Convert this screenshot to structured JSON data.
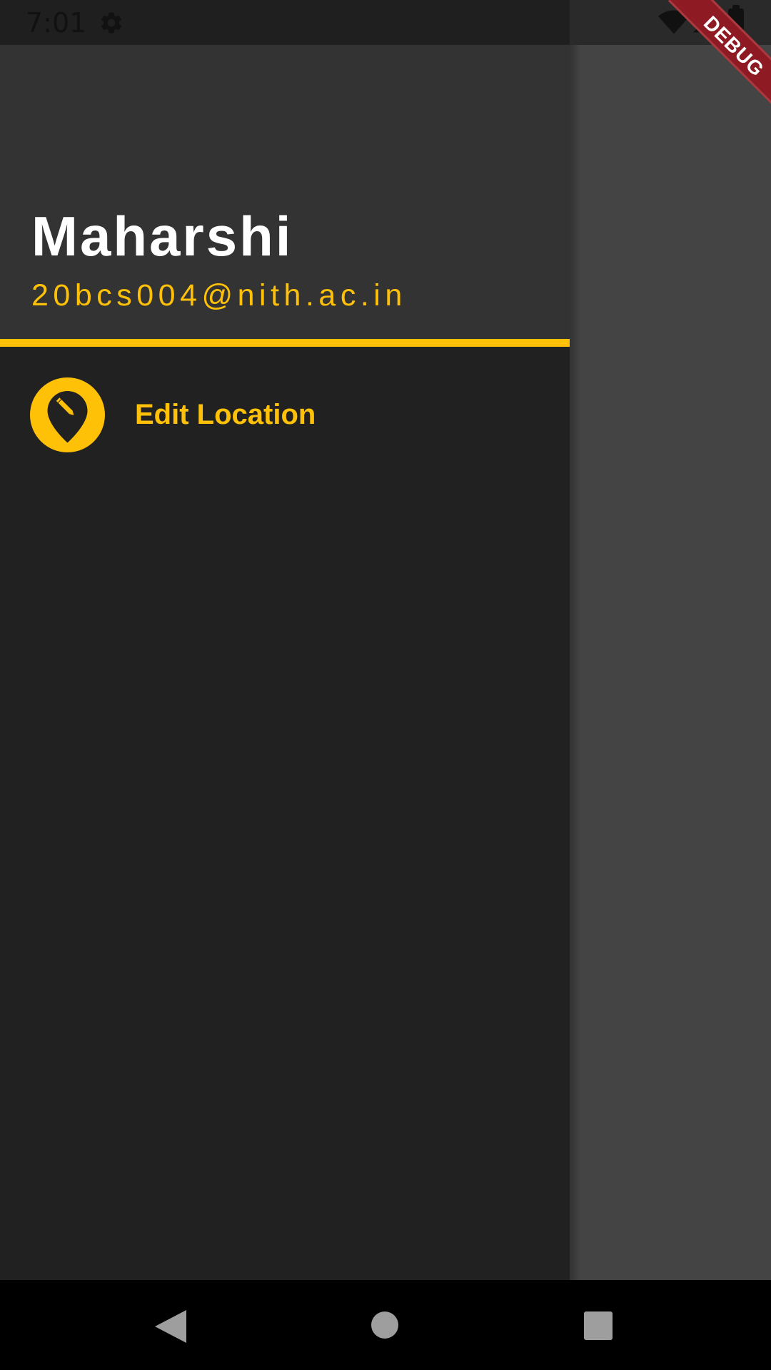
{
  "status_bar": {
    "time": "7:01",
    "icons": [
      "gear-icon",
      "wifi-icon",
      "signal-icon",
      "battery-icon"
    ]
  },
  "debug_banner": {
    "label": "DEBUG"
  },
  "drawer": {
    "header": {
      "name": "Maharshi",
      "email": "20bcs004@nith.ac.in"
    },
    "items": [
      {
        "label": "Edit Location",
        "icon": "edit-location-icon"
      }
    ]
  },
  "navigation_bar": {
    "buttons": [
      "back",
      "home",
      "recents"
    ]
  },
  "colors": {
    "accent": "#ffc107",
    "drawer_background": "#212121",
    "header_background": "#333333",
    "scrim": "#444444"
  }
}
